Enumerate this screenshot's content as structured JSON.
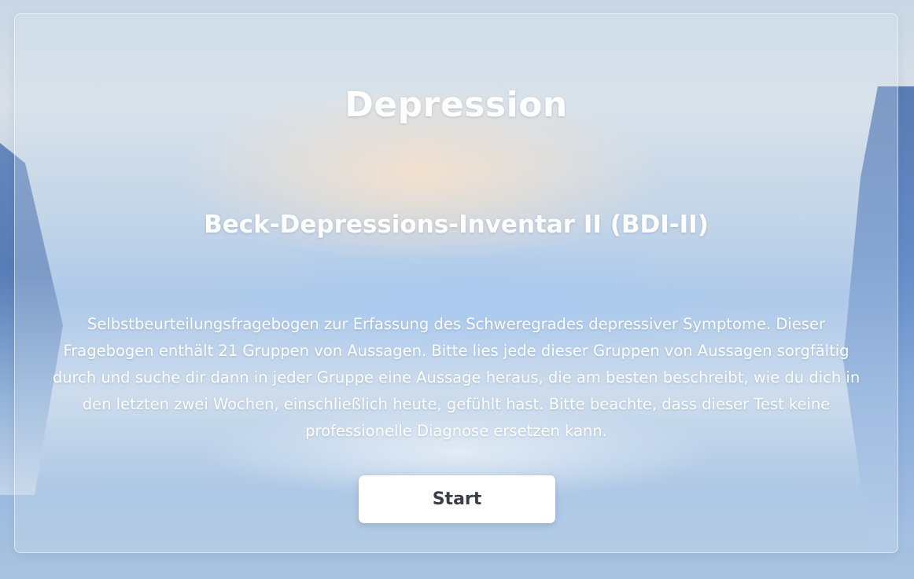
{
  "page": {
    "title": "Depression",
    "subtitle": "Beck-Depressions-Inventar II (BDI-II)",
    "description": "Selbstbeurteilungsfragebogen zur Erfassung des Schweregrades depressiver Symptome. Dieser Fragebogen enthält 21 Gruppen von Aussagen. Bitte lies jede dieser Gruppen von Aussagen sorgfältig durch und suche dir dann in jeder Gruppe eine Aussage heraus, die am besten beschreibt, wie du dich in den letzten zwei Wochen, einschließlich heute, gefühlt hast. Bitte beachte, dass dieser Test keine professionelle Diagnose ersetzen kann.",
    "start_label": "Start"
  },
  "colors": {
    "text": "#ffffff",
    "button_background": "#ffffff",
    "button_text": "#3a3d4a"
  }
}
